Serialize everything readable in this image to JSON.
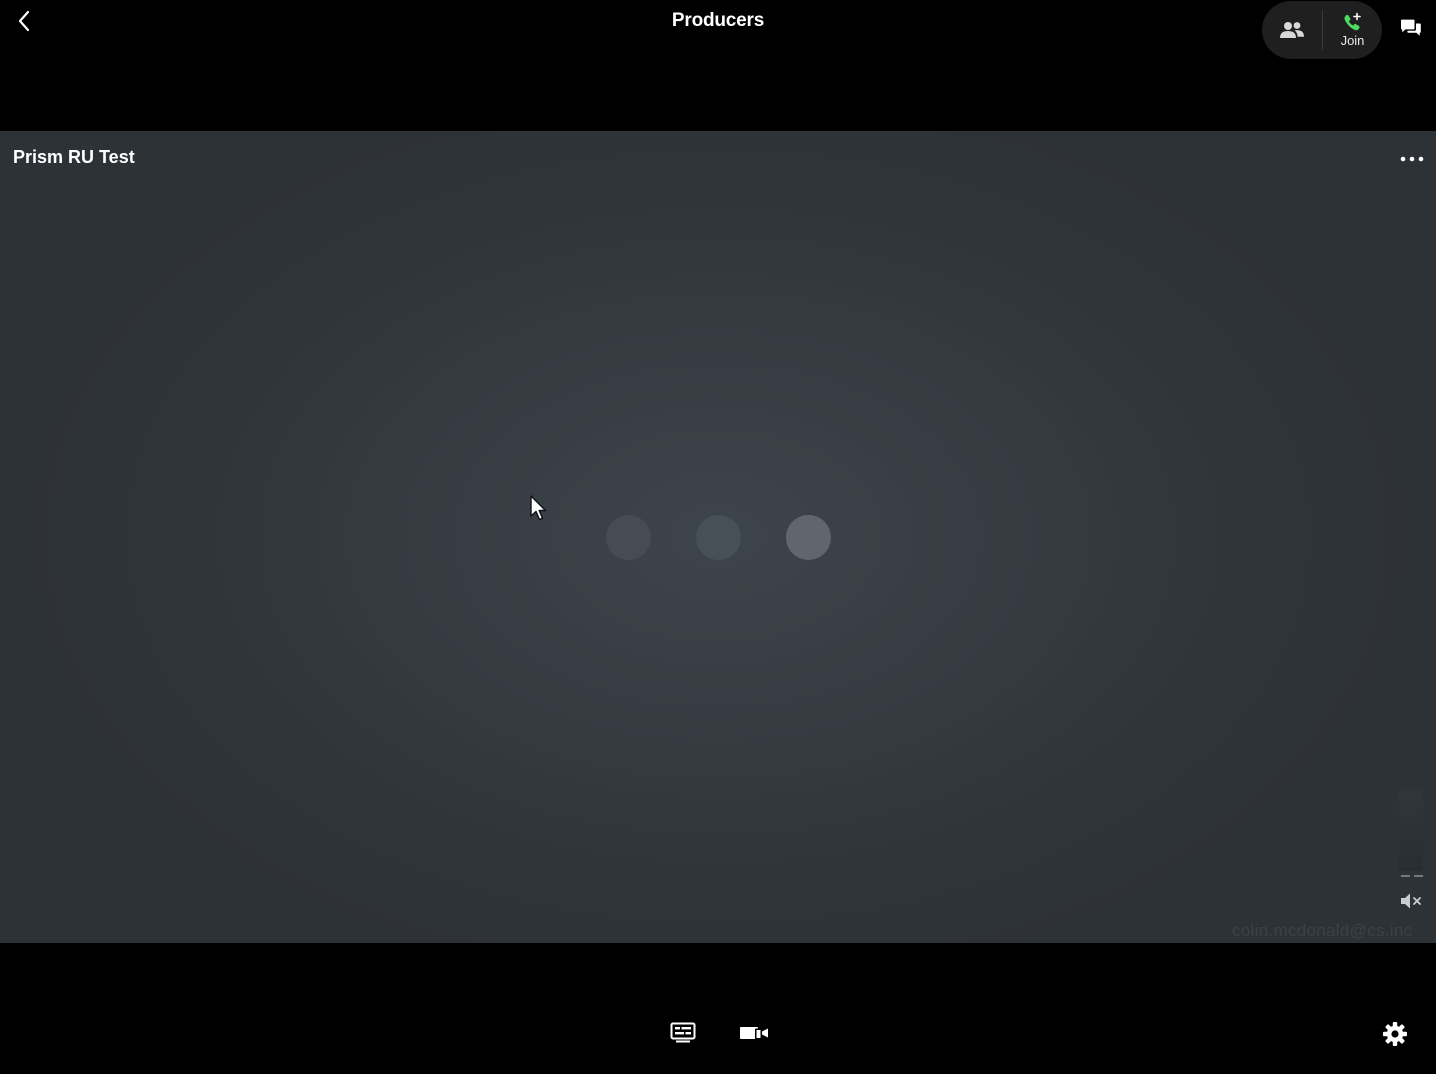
{
  "header": {
    "title": "Producers",
    "join_label": "Join",
    "back_icon": "chevron-left-icon",
    "participants_icon": "people-icon",
    "join_icon": "phone-plus-icon",
    "chat_icon": "chat-bubbles-icon"
  },
  "stage": {
    "title": "Prism RU Test",
    "more_icon": "more-horizontal-icon",
    "loading_indicator": {
      "dot_count": 3,
      "active_dot": 3
    },
    "mute_icon": "speaker-muted-icon",
    "watermark": "colin.mcdonald@cs.inc"
  },
  "footer": {
    "captions_icon": "captions-icon",
    "cast_icon": "cast-devices-icon",
    "settings_icon": "gear-icon"
  },
  "colors": {
    "background": "#000000",
    "stage_center": "#3d444b",
    "stage_edge": "#2d3236",
    "join_accent": "#4cd964",
    "pill_background": "#1f1f1f",
    "text": "#ffffff"
  }
}
